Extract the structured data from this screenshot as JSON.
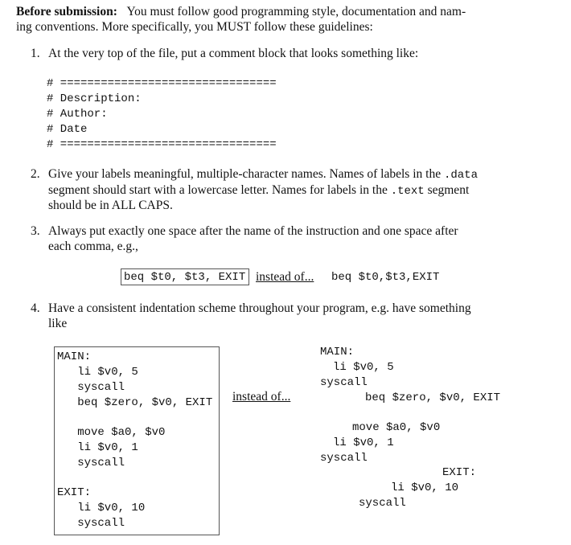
{
  "intro": {
    "bold_label": "Before submission:",
    "line1_rest": "You must follow good programming style, documentation and nam-",
    "line2": "ing conventions. More specifically, you MUST follow these guidelines:"
  },
  "items": [
    {
      "number": "1.",
      "lines": [
        "At the very top of the file, put a comment block that looks something like:"
      ],
      "code": [
        "# ================================",
        "# Description:",
        "# Author:",
        "# Date",
        "# ================================"
      ]
    },
    {
      "number": "2.",
      "line1_pre": "Give your labels meaningful, multiple-character names. Names of labels in the ",
      "line1_code": ".data",
      "line2_pre": "segment should start with a lowercase letter. Names for labels in the ",
      "line2_code": ".text",
      "line2_post": " segment",
      "line3": "should be in ALL CAPS."
    },
    {
      "number": "3.",
      "lines": [
        "Always put exactly one space after the name of the instruction and one space after",
        "each comma, e.g.,"
      ],
      "good_example": "beq $t0, $t3, EXIT",
      "instead_of": "instead of...",
      "bad_example": "beq $t0,$t3,EXIT"
    },
    {
      "number": "4.",
      "lines": [
        "Have a consistent indentation scheme throughout your program, e.g. have something",
        "like"
      ],
      "good_code": [
        "MAIN:",
        "   li $v0, 5",
        "   syscall",
        "   beq $zero, $v0, EXIT",
        "",
        "   move $a0, $v0",
        "   li $v0, 1",
        "   syscall",
        "",
        "EXIT:",
        "   li $v0, 10",
        "   syscall"
      ],
      "instead_of": "instead of...",
      "bad_code": [
        "MAIN:",
        "li $v0, 5",
        "syscall",
        "beq $zero, $v0, EXIT",
        "move $a0, $v0",
        "li $v0, 1",
        "syscall",
        "EXIT:",
        "li $v0, 10",
        "syscall"
      ]
    }
  ]
}
